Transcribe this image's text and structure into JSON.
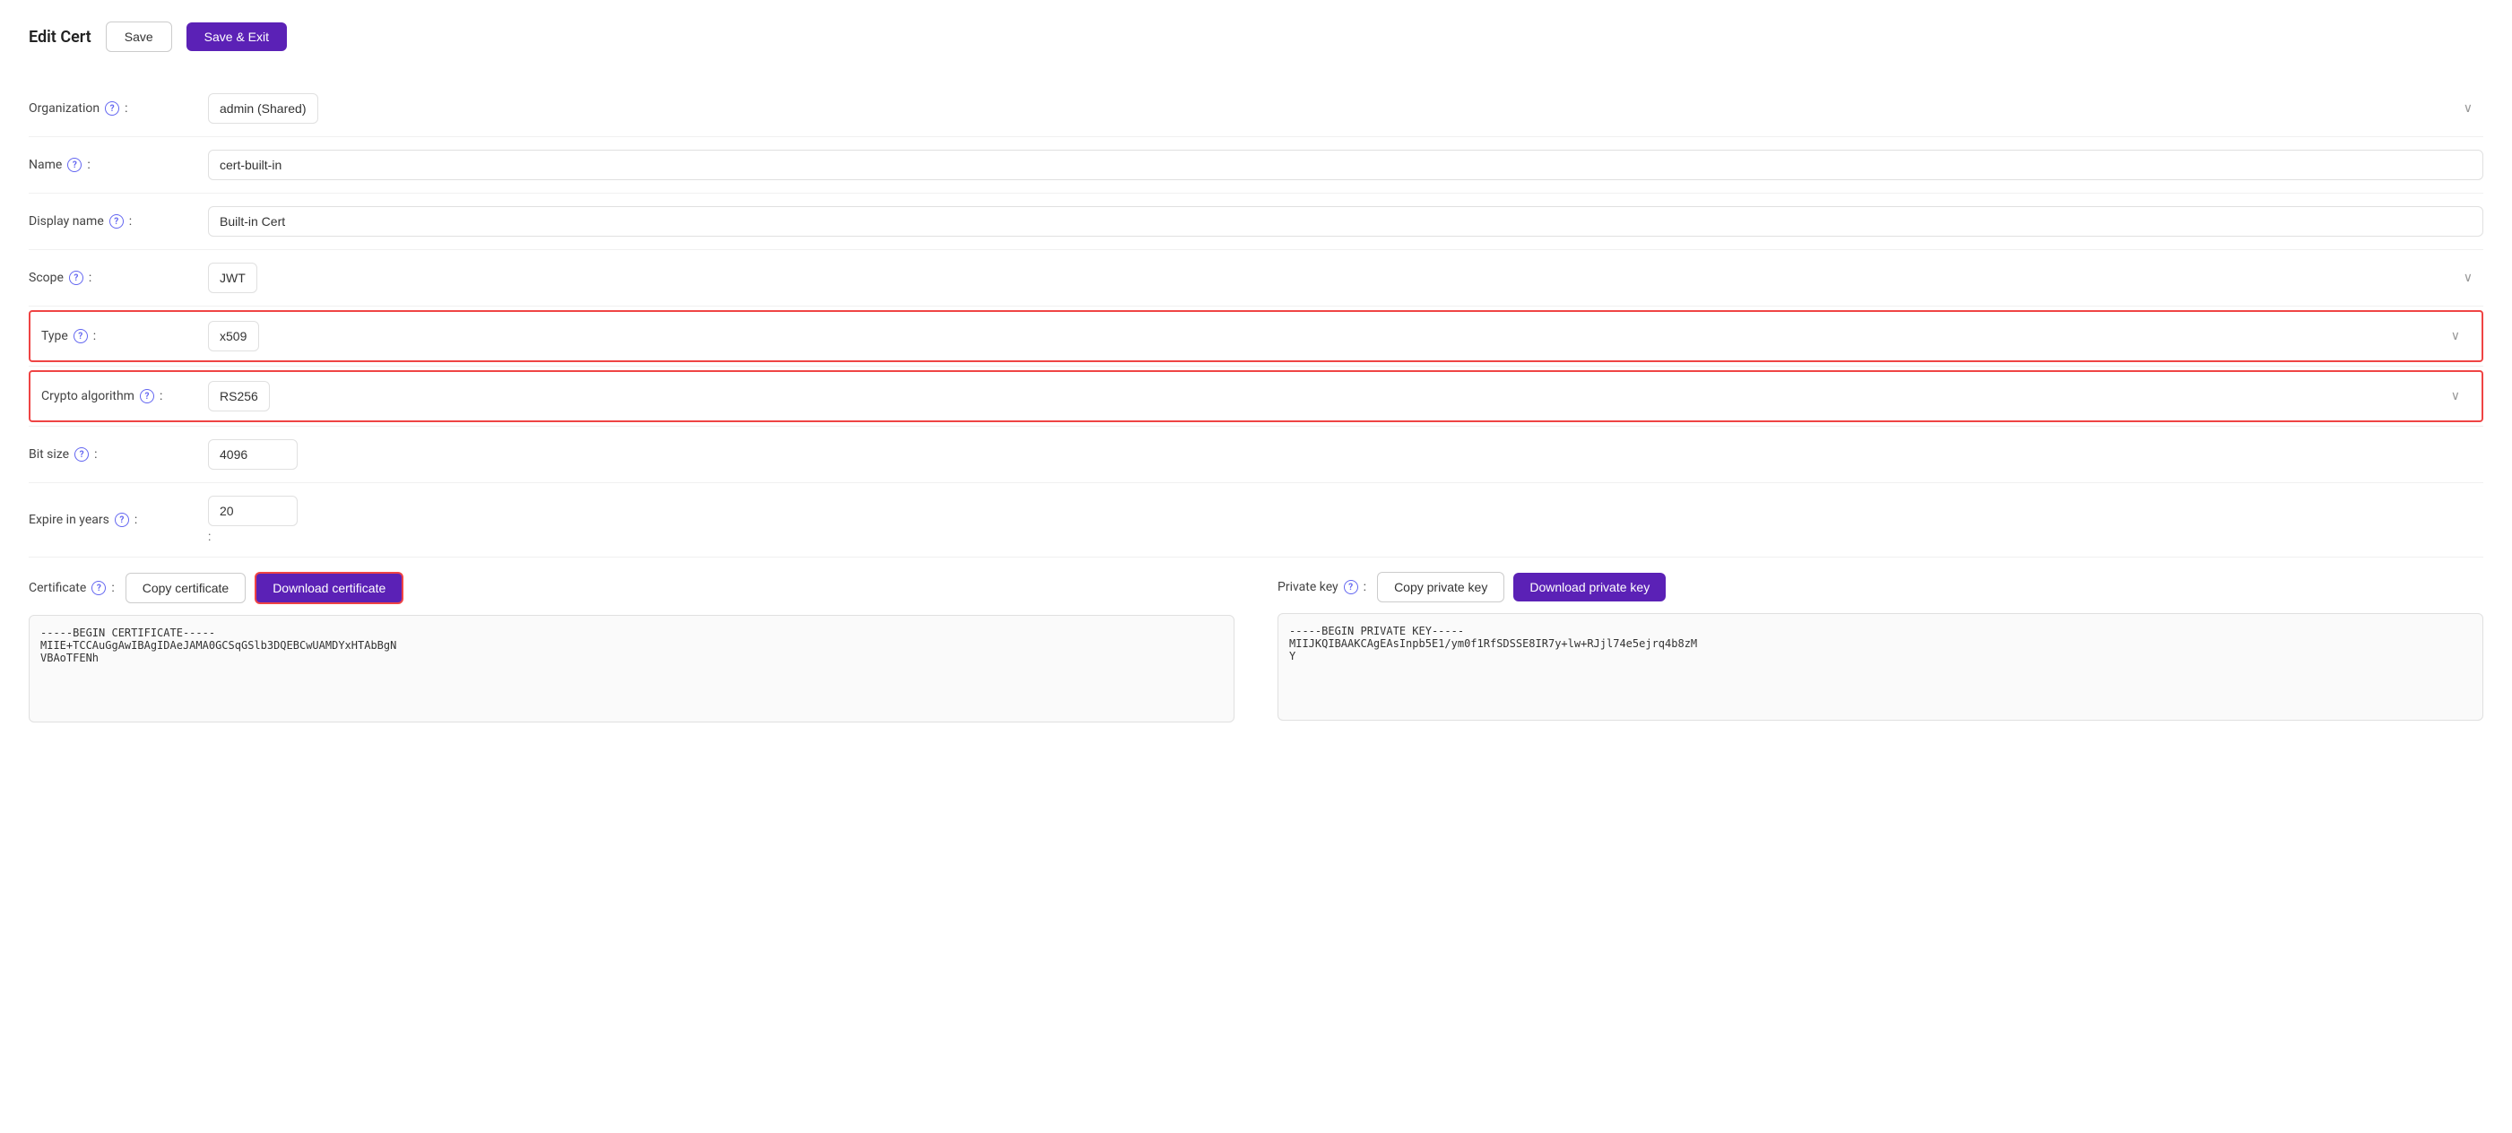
{
  "header": {
    "title": "Edit Cert",
    "save_label": "Save",
    "save_exit_label": "Save & Exit"
  },
  "form": {
    "organization_label": "Organization",
    "organization_value": "admin (Shared)",
    "name_label": "Name",
    "name_value": "cert-built-in",
    "display_name_label": "Display name",
    "display_name_value": "Built-in Cert",
    "scope_label": "Scope",
    "scope_value": "JWT",
    "type_label": "Type",
    "type_value": "x509",
    "crypto_label": "Crypto algorithm",
    "crypto_value": "RS256",
    "bit_size_label": "Bit size",
    "bit_size_value": "4096",
    "expire_label": "Expire in years",
    "expire_value": "20",
    "expire_colon": ":",
    "certificate_label": "Certificate",
    "certificate_copy_label": "Copy certificate",
    "certificate_download_label": "Download certificate",
    "certificate_content": "-----BEGIN CERTIFICATE-----\nMIIE+TCCAuGgAwIBAgIDAeJAMA0GCSqGSlb3DQEBCwUAMDYxHTAbBgN\nVBAoTFENh",
    "private_key_label": "Private key",
    "private_key_copy_label": "Copy private key",
    "private_key_download_label": "Download private key",
    "private_key_content": "-----BEGIN PRIVATE KEY-----\nMIIJKQIBAAKCAgEAsInpb5E1/ym0f1RfSDSSE8IR7y+lw+RJjl74e5ejrq4b8zM\nY"
  },
  "icons": {
    "help": "?",
    "chevron_down": "⌄"
  }
}
